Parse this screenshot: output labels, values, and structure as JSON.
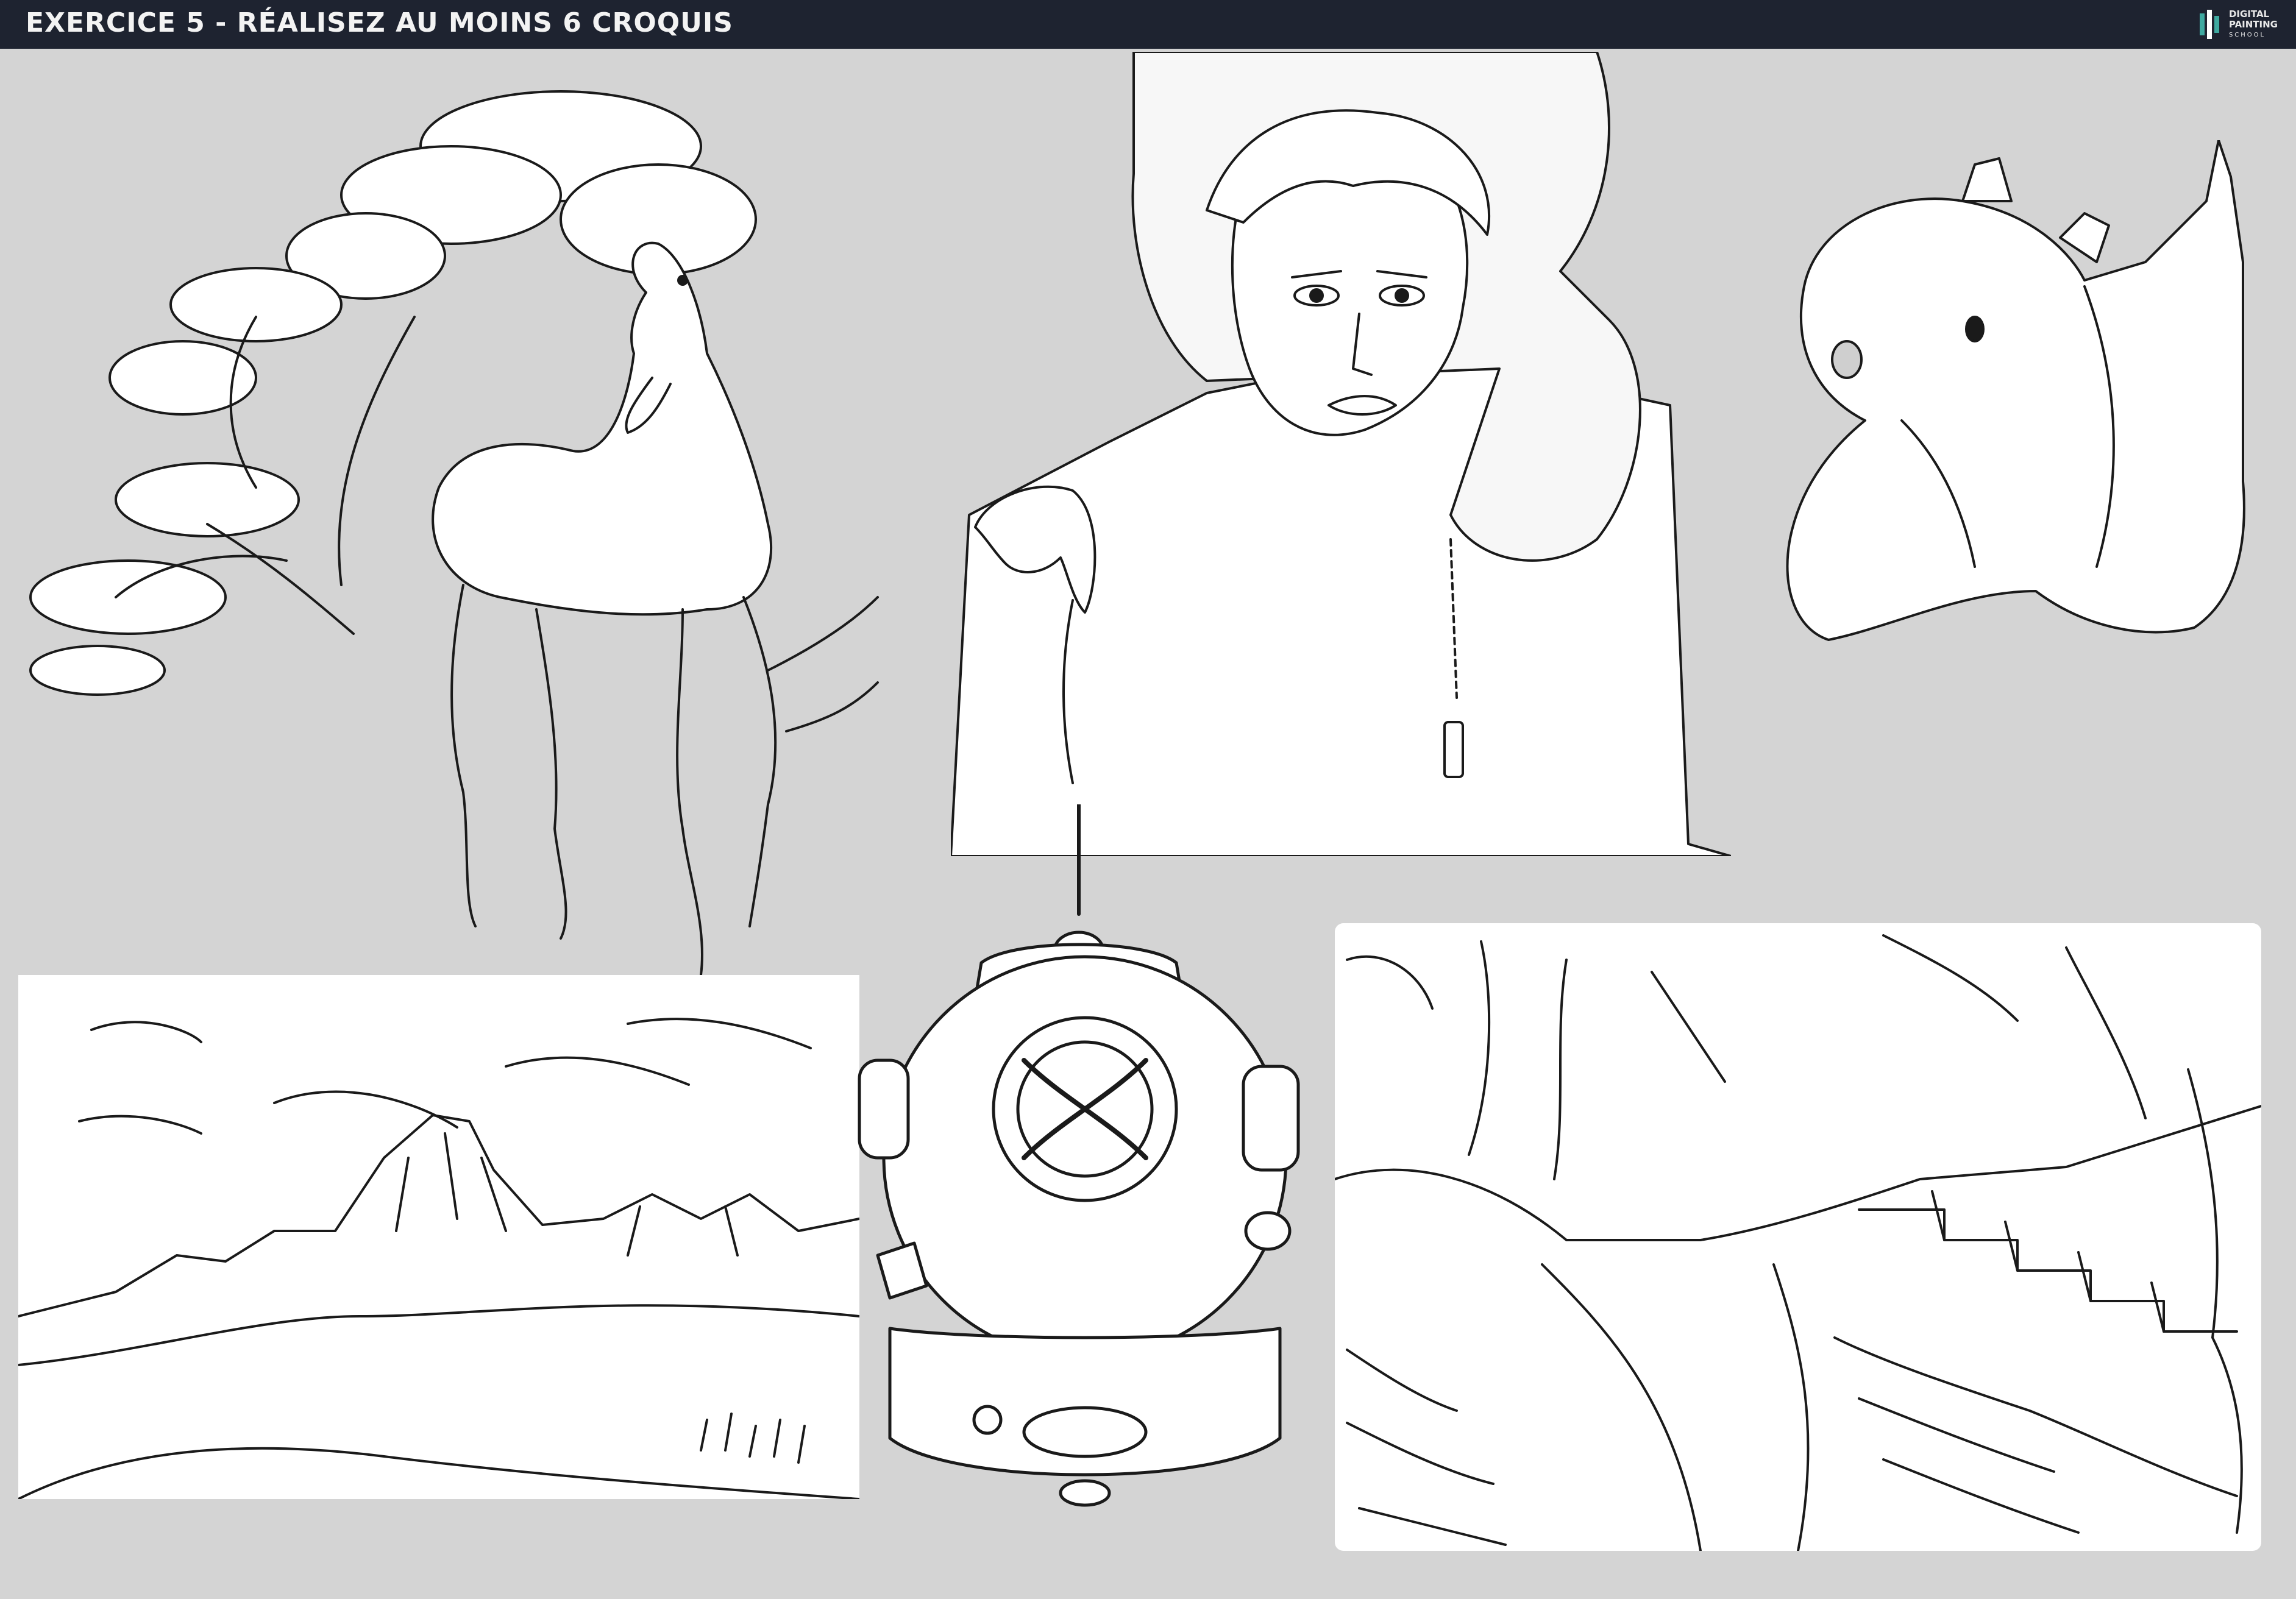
{
  "header": {
    "title": "EXERCICE 5 - RÉALISEZ AU MOINS 6 CROQUIS",
    "logo": {
      "line1": "DIGITAL",
      "line2": "PAINTING",
      "line3": "SCHOOL"
    }
  },
  "colors": {
    "header_bg": "#1e2330",
    "page_bg": "#d4d4d4",
    "ink": "#1a1a1a",
    "logo_accent": "#3fa9a0"
  },
  "sketches": [
    {
      "subject": "horse with tree branches"
    },
    {
      "subject": "woman in fur-hooded coat"
    },
    {
      "subject": "plush dragon toy"
    },
    {
      "subject": "mountain landscape"
    },
    {
      "subject": "diving helmet"
    },
    {
      "subject": "forest river with stone stairs"
    }
  ]
}
